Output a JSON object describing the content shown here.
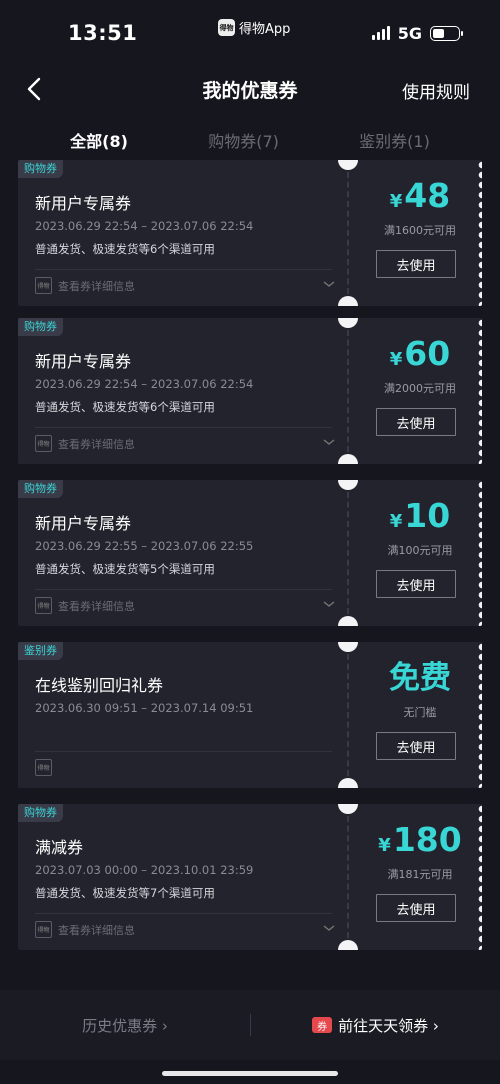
{
  "status": {
    "time": "13:51",
    "app_name": "得物App",
    "network": "5G",
    "app_logo": "得物",
    "battery_level": 0.45
  },
  "nav": {
    "title": "我的优惠券",
    "rules": "使用规则"
  },
  "tabs": [
    {
      "label": "全部(8)",
      "active": true
    },
    {
      "label": "购物券(7)",
      "active": false
    },
    {
      "label": "鉴别券(1)",
      "active": false
    }
  ],
  "coupons": [
    {
      "tag": "购物券",
      "title": "新用户专属券",
      "date": "2023.06.29 22:54 – 2023.07.06 22:54",
      "channels": "普通发货、极速发货等6个渠道可用",
      "detail": "查看券详细信息",
      "currency": "¥",
      "amount": "48",
      "condition": "满1600元可用",
      "button": "去使用"
    },
    {
      "tag": "购物券",
      "title": "新用户专属券",
      "date": "2023.06.29 22:54 – 2023.07.06 22:54",
      "channels": "普通发货、极速发货等6个渠道可用",
      "detail": "查看券详细信息",
      "currency": "¥",
      "amount": "60",
      "condition": "满2000元可用",
      "button": "去使用"
    },
    {
      "tag": "购物券",
      "title": "新用户专属券",
      "date": "2023.06.29 22:55 – 2023.07.06 22:55",
      "channels": "普通发货、极速发货等5个渠道可用",
      "detail": "查看券详细信息",
      "currency": "¥",
      "amount": "10",
      "condition": "满100元可用",
      "button": "去使用"
    },
    {
      "tag": "鉴别券",
      "title": "在线鉴别回归礼券",
      "date": "2023.06.30 09:51 – 2023.07.14 09:51",
      "channels": "",
      "detail": "",
      "currency": "",
      "amount": "免费",
      "condition": "无门槛",
      "button": "去使用"
    },
    {
      "tag": "购物券",
      "title": "满减券",
      "date": "2023.07.03 00:00 – 2023.10.01 23:59",
      "channels": "普通发货、极速发货等7个渠道可用",
      "detail": "查看券详细信息",
      "currency": "¥",
      "amount": "180",
      "condition": "满181元可用",
      "button": "去使用"
    }
  ],
  "bottom": {
    "history": "历史优惠券 ›",
    "quan_icon": "券",
    "get_more": "前往天天领券 ›"
  },
  "colors": {
    "accent": "#39d6d6",
    "background": "#16161e",
    "card": "#23232d"
  }
}
